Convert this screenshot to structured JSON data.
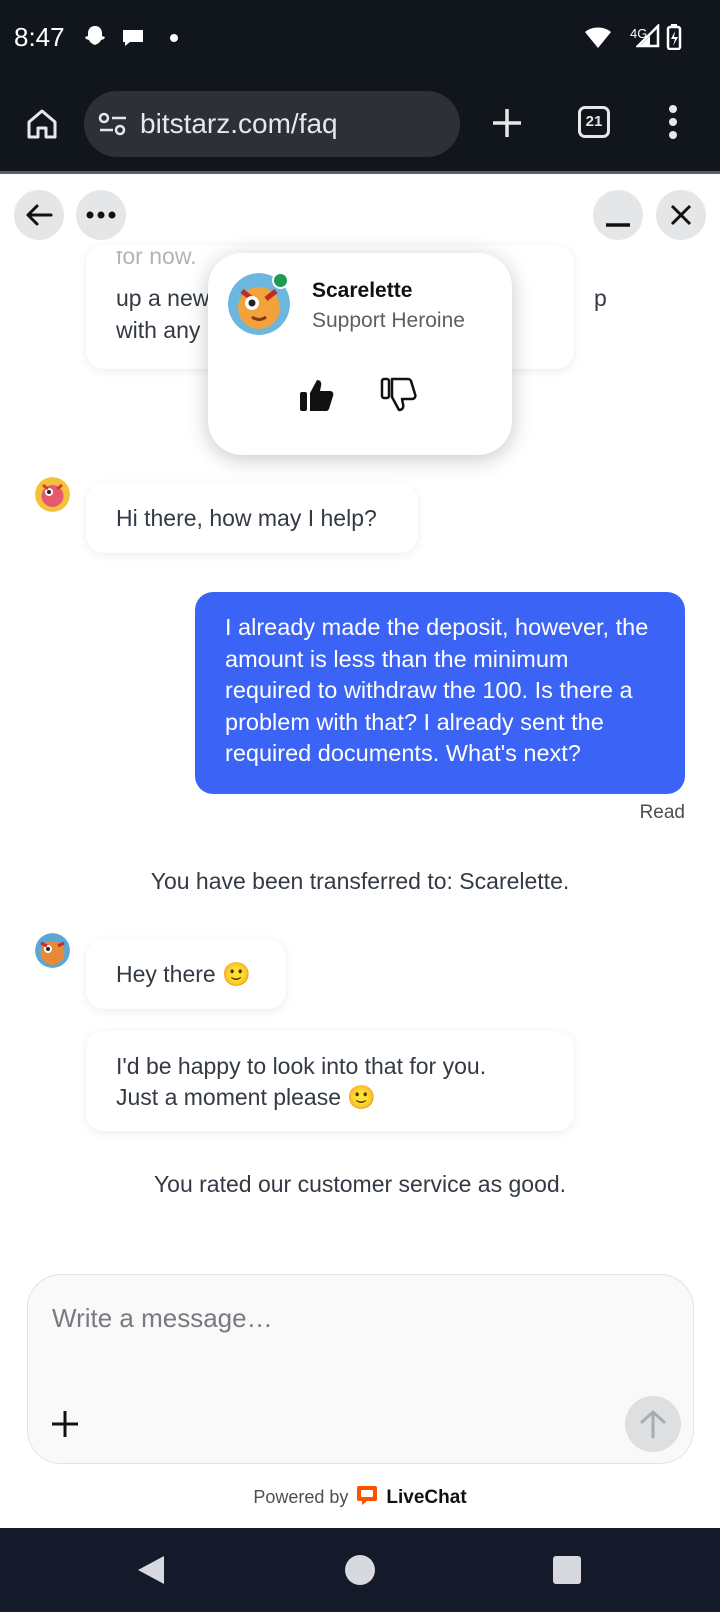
{
  "status_bar": {
    "time": "8:47",
    "network": "4G"
  },
  "browser": {
    "url": "bitstarz.com/faq",
    "tab_count": "21"
  },
  "agent": {
    "name": "Scarelette",
    "role": "Support Heroine"
  },
  "messages": {
    "partial_line_1": "for now.",
    "partial_line_2": "up a new",
    "partial_line_2_end": "p",
    "partial_line_3": "with any",
    "greeting": "Hi there, how may I help?",
    "user_message": "I already made the deposit, however, the amount is less than the minimum required to withdraw the 100. Is there a problem with that? I already sent the required documents. What's next?",
    "read_status": "Read",
    "transfer_notice": "You have been transferred to: Scarelette.",
    "agent_msg_1": "Hey there 🙂",
    "agent_msg_2_line1": "I'd be happy to look into that for you.",
    "agent_msg_2_line2": "Just a moment please 🙂",
    "rating_notice": "You rated our customer service as good."
  },
  "composer": {
    "placeholder": "Write a message…"
  },
  "footer": {
    "powered_by": "Powered by",
    "brand": "LiveChat"
  },
  "colors": {
    "user_bubble": "#3b63f5",
    "online": "#1f9a55",
    "brand_orange": "#ff5100"
  }
}
